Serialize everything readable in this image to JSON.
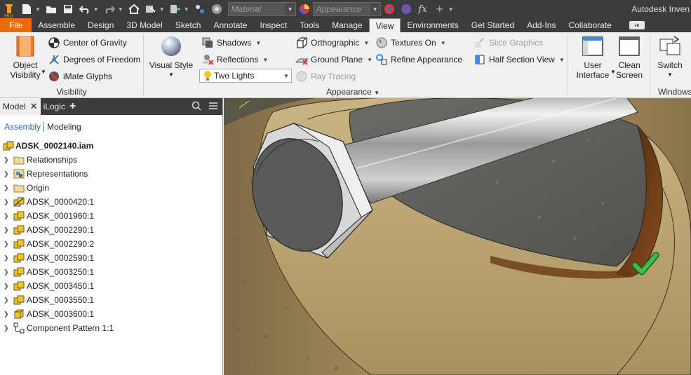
{
  "app": {
    "title": "Autodesk Inven"
  },
  "quick_access": {
    "material_placeholder": "Material",
    "appearance_placeholder": "Appearance"
  },
  "tabs": [
    "File",
    "Assemble",
    "Design",
    "3D Model",
    "Sketch",
    "Annotate",
    "Inspect",
    "Tools",
    "Manage",
    "View",
    "Environments",
    "Get Started",
    "Add-Ins",
    "Collaborate"
  ],
  "active_tab": "View",
  "ribbon": {
    "visibility": {
      "title": "Visibility",
      "object_visibility": [
        "Object",
        "Visibility"
      ],
      "center_of_gravity": "Center of Gravity",
      "degrees_of_freedom": "Degrees of Freedom",
      "imate_glyphs": "iMate Glyphs"
    },
    "appearance": {
      "title": "Appearance",
      "visual_style": "Visual Style",
      "shadows": "Shadows",
      "reflections": "Reflections",
      "lighting": "Two Lights",
      "orthographic": "Orthographic",
      "ground_plane": "Ground Plane",
      "ray_tracing": "Ray Tracing",
      "textures_on": "Textures On",
      "refine_appearance": "Refine Appearance",
      "slice_graphics": "Slice Graphics",
      "half_section_view": "Half Section View"
    },
    "windows": {
      "title": "Windows",
      "user_interface": [
        "User",
        "Interface"
      ],
      "clean_screen": [
        "Clean",
        "Screen"
      ],
      "switch": "Switch"
    }
  },
  "browser": {
    "tabs": {
      "model": "Model",
      "ilogic": "iLogic"
    },
    "modes": {
      "assembly": "Assembly",
      "modeling": "Modeling"
    },
    "root": "ADSK_0002140.iam",
    "items": [
      {
        "label": "Relationships",
        "kind": "folder"
      },
      {
        "label": "Representations",
        "kind": "representations"
      },
      {
        "label": "Origin",
        "kind": "folder"
      },
      {
        "label": "ADSK_0000420:1",
        "kind": "assembly-special"
      },
      {
        "label": "ADSK_0001960:1",
        "kind": "assembly"
      },
      {
        "label": "ADSK_0002290:1",
        "kind": "assembly"
      },
      {
        "label": "ADSK_0002290:2",
        "kind": "assembly"
      },
      {
        "label": "ADSK_0002590:1",
        "kind": "assembly"
      },
      {
        "label": "ADSK_0003250:1",
        "kind": "assembly"
      },
      {
        "label": "ADSK_0003450:1",
        "kind": "assembly"
      },
      {
        "label": "ADSK_0003550:1",
        "kind": "assembly"
      },
      {
        "label": "ADSK_0003600:1",
        "kind": "part"
      },
      {
        "label": "Component Pattern 1:1",
        "kind": "pattern"
      }
    ]
  },
  "colors": {
    "file_tab": "#e86b0c",
    "dark_chrome": "#3c3c3c",
    "assembly_link": "#2a6ab3",
    "checkmark": "#2e9e3a"
  }
}
